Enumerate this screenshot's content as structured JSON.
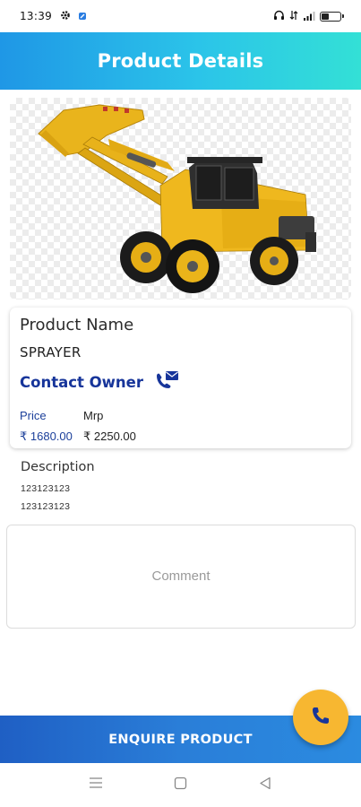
{
  "status_bar": {
    "time": "13:39",
    "icons": [
      "gear-icon",
      "app-notification-icon",
      "headphones-icon",
      "mobile-data-icon",
      "signal-icon",
      "battery-icon"
    ]
  },
  "header": {
    "title": "Product Details"
  },
  "product": {
    "image_description_icon": "wheel-loader-image",
    "name_label": "Product Name",
    "name": "SPRAYER",
    "contact_label": "Contact Owner",
    "price_label": "Price",
    "mrp_label": "Mrp",
    "price": "₹ 1680.00",
    "mrp": "₹ 2250.00"
  },
  "description": {
    "label": "Description",
    "lines": [
      "123123123",
      "123123123"
    ]
  },
  "comment": {
    "placeholder": "Comment",
    "value": ""
  },
  "actions": {
    "enquire_label": "ENQUIRE PRODUCT"
  },
  "colors": {
    "header_gradient_start": "#1f97e6",
    "header_gradient_end": "#33e0d6",
    "accent_blue": "#17359a",
    "fab_yellow": "#f7b731",
    "enquire_blue": "#2a7ed8"
  }
}
